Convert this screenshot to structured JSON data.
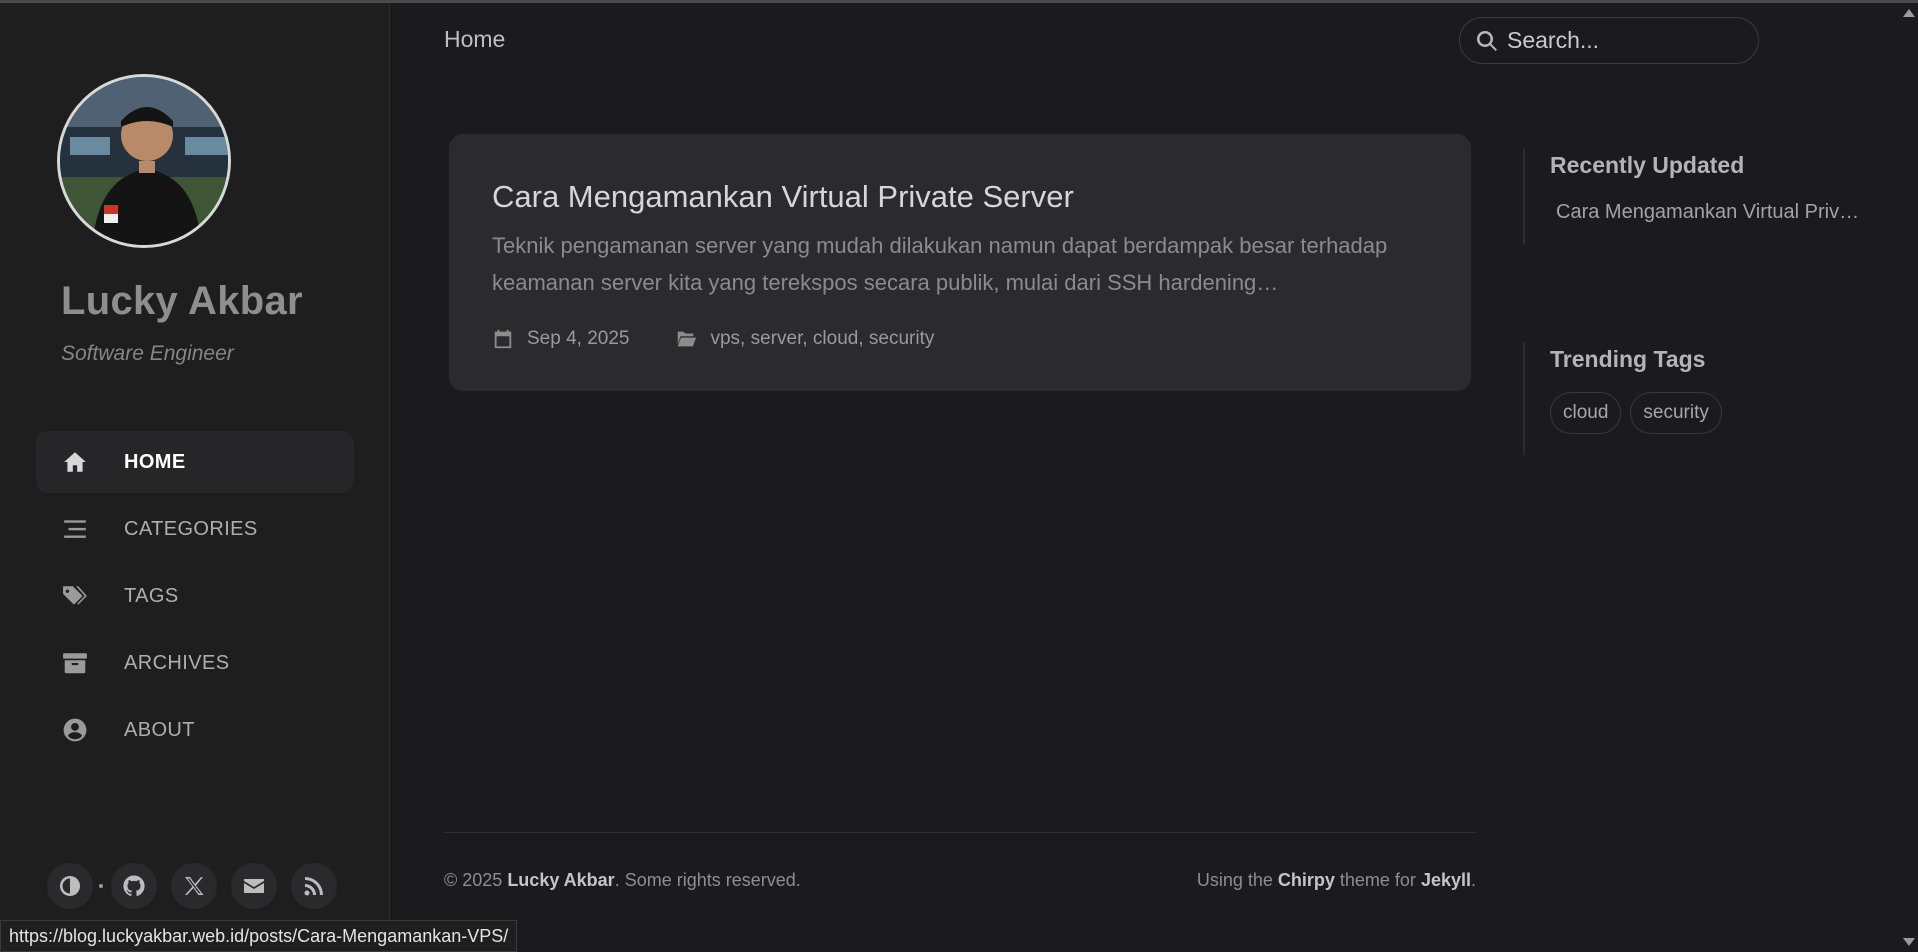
{
  "site": {
    "title": "Lucky Akbar",
    "subtitle": "Software Engineer",
    "avatar_alt": "avatar"
  },
  "nav": {
    "items": [
      {
        "label": "HOME",
        "icon": "home-icon",
        "active": true
      },
      {
        "label": "CATEGORIES",
        "icon": "stream-icon",
        "active": false
      },
      {
        "label": "TAGS",
        "icon": "tags-icon",
        "active": false
      },
      {
        "label": "ARCHIVES",
        "icon": "archive-icon",
        "active": false
      },
      {
        "label": "ABOUT",
        "icon": "user-circle-icon",
        "active": false
      }
    ]
  },
  "sidebar_bottom": {
    "buttons": [
      "theme-toggle-icon",
      "github-icon",
      "x-twitter-icon",
      "email-icon",
      "rss-icon"
    ]
  },
  "topbar": {
    "breadcrumb": "Home",
    "search_placeholder": "Search..."
  },
  "post": {
    "title": "Cara Mengamankan Virtual Private Server",
    "excerpt": "Teknik pengamanan server yang mudah dilakukan namun dapat berdampak besar terhadap keamanan server kita yang terekspos secara publik, mulai dari SSH hardening…",
    "date": "Sep 4, 2025",
    "categories": "vps, server, cloud, security"
  },
  "panel": {
    "recent_title": "Recently Updated",
    "recent_items": [
      "Cara Mengamankan Virtual Priv…"
    ],
    "trending_title": "Trending Tags",
    "tags": [
      "cloud",
      "security"
    ]
  },
  "footer": {
    "copyright_prefix": "© 2025 ",
    "owner": "Lucky Akbar",
    "rights": ". Some rights reserved.",
    "using_prefix": "Using the ",
    "theme": "Chirpy",
    "theme_mid": " theme for ",
    "engine": "Jekyll",
    "end": "."
  },
  "status": {
    "url": "https://blog.luckyakbar.web.id/posts/Cara-Mengamankan-VPS/"
  },
  "colors": {
    "background": "#1b1b1e",
    "sidebar": "#1e1e1e",
    "card": "#2b2b2e",
    "active_nav": "#262628"
  }
}
